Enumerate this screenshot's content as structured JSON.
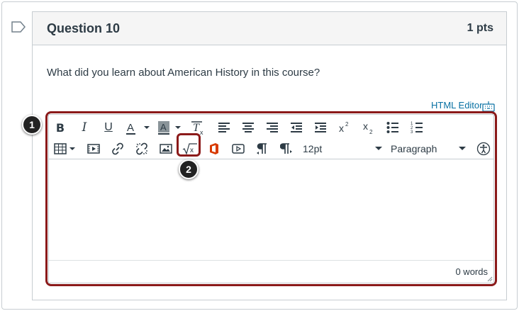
{
  "question": {
    "title": "Question 10",
    "points": "1 pts",
    "text": "What did you learn about American History in this course?"
  },
  "editor": {
    "html_editor_link": "HTML Editor",
    "font_size": "12pt",
    "block_format": "Paragraph",
    "word_count": "0 words"
  },
  "callouts": {
    "one": "1",
    "two": "2"
  },
  "colors": {
    "highlight": "#8b1a1a",
    "link": "#0770a3",
    "text": "#2d3b45"
  },
  "icons": [
    "bold-icon",
    "italic-icon",
    "underline-icon",
    "text-color-icon",
    "background-color-icon",
    "clear-formatting-icon",
    "align-left-icon",
    "align-center-icon",
    "align-right-icon",
    "outdent-icon",
    "indent-icon",
    "superscript-icon",
    "subscript-icon",
    "bullet-list-icon",
    "numbered-list-icon",
    "table-icon",
    "media-icon",
    "link-icon",
    "unlink-icon",
    "image-icon",
    "math-equation-icon",
    "office-icon",
    "video-icon",
    "ltr-paragraph-icon",
    "rtl-paragraph-icon",
    "accessibility-icon"
  ]
}
